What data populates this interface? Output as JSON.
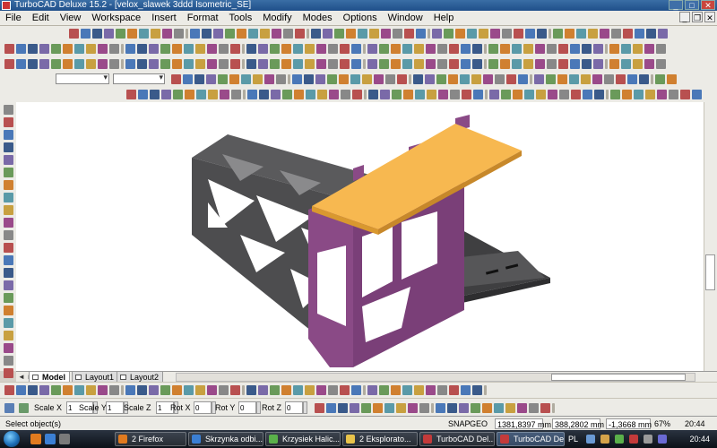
{
  "window": {
    "title": "TurboCAD Deluxe 15.2 - [velox_slawek 3ddd Isometric_SE]",
    "min": "_",
    "max": "□",
    "close": "✕"
  },
  "menu": {
    "items": [
      "File",
      "Edit",
      "View",
      "Workspace",
      "Insert",
      "Format",
      "Tools",
      "Modify",
      "Modes",
      "Options",
      "Window",
      "Help"
    ]
  },
  "tabs": {
    "nav": "◄ ► ►|",
    "items": [
      "Model",
      "Layout1",
      "Layout2"
    ],
    "active": "Model"
  },
  "inspector": {
    "fields": [
      {
        "label": "Scale X",
        "value": "1"
      },
      {
        "label": "Scale Y",
        "value": "1"
      },
      {
        "label": "Scale Z",
        "value": "1"
      },
      {
        "label": "Rot X",
        "value": "0"
      },
      {
        "label": "Rot Y",
        "value": "0"
      },
      {
        "label": "Rot Z",
        "value": "0"
      }
    ]
  },
  "status": {
    "text": "Select object(s)",
    "snap": "SNAP",
    "geo": "GEO",
    "x": "1381,8397 mm",
    "y": "388,2802 mm",
    "z": "-1,3668 mm",
    "zoom": "67%",
    "time": "20:44"
  },
  "taskbar": {
    "items": [
      {
        "label": "2 Firefox",
        "color": "#e07a1f"
      },
      {
        "label": "Skrzynka odbi...",
        "color": "#3b7fd4"
      },
      {
        "label": "Krzysiek Halic...",
        "color": "#5ab04a"
      },
      {
        "label": "2 Eksplorato...",
        "color": "#e8c34a"
      },
      {
        "label": "TurboCAD Del...",
        "color": "#c33a3a"
      },
      {
        "label": "TurboCAD Del...",
        "color": "#c33a3a"
      }
    ],
    "lang": "PL",
    "time": "20:44"
  },
  "colors": {
    "frame_dark": "#4d4d4f",
    "frame_side": "#3a3a3c",
    "purple": "#8a4a86",
    "orange": "#f7b850",
    "orange_edge": "#d9982f"
  },
  "icons": {
    "toolbar_row1": 64,
    "toolbar_row2": 60,
    "toolbar_row3": 58
  }
}
